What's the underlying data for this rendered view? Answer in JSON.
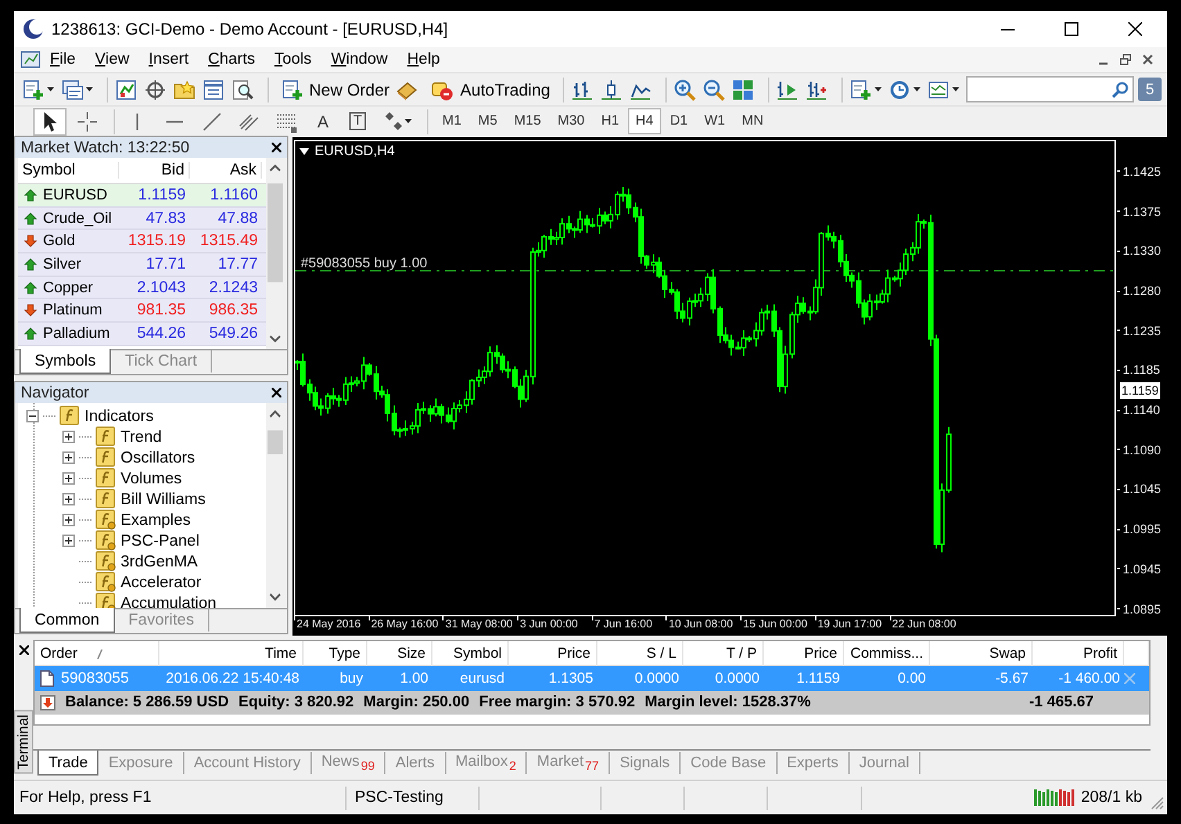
{
  "window": {
    "title": "1238613: GCI-Demo - Demo Account - [EURUSD,H4]"
  },
  "menu": [
    "File",
    "View",
    "Insert",
    "Charts",
    "Tools",
    "Window",
    "Help"
  ],
  "toolbar": {
    "new_order": "New Order",
    "auto_trading": "AutoTrading",
    "notifications": "5"
  },
  "drawing_tools": [
    {
      "kind": "cursor",
      "selected": true
    },
    {
      "kind": "crosshair",
      "selected": false
    },
    {
      "kind": "vertical-line",
      "selected": false
    },
    {
      "kind": "horizontal-line",
      "selected": false
    },
    {
      "kind": "trend-line",
      "selected": false
    },
    {
      "kind": "channel",
      "selected": false
    },
    {
      "kind": "fibonacci",
      "selected": false
    },
    {
      "kind": "text",
      "glyph": "A",
      "selected": false
    },
    {
      "kind": "label",
      "glyph": "T",
      "selected": false
    },
    {
      "kind": "shapes",
      "selected": false
    }
  ],
  "timeframes": [
    {
      "label": "M1",
      "selected": false
    },
    {
      "label": "M5",
      "selected": false
    },
    {
      "label": "M15",
      "selected": false
    },
    {
      "label": "M30",
      "selected": false
    },
    {
      "label": "H1",
      "selected": false
    },
    {
      "label": "H4",
      "selected": true
    },
    {
      "label": "D1",
      "selected": false
    },
    {
      "label": "W1",
      "selected": false
    },
    {
      "label": "MN",
      "selected": false
    }
  ],
  "market_watch": {
    "title": "Market Watch: 13:22:50",
    "columns": [
      "Symbol",
      "Bid",
      "Ask"
    ],
    "rows": [
      {
        "symbol": "EURUSD",
        "bid": "1.1159",
        "ask": "1.1160",
        "rising": true,
        "selected": true
      },
      {
        "symbol": "Crude_Oil",
        "bid": "47.83",
        "ask": "47.88",
        "rising": true,
        "selected": false
      },
      {
        "symbol": "Gold",
        "bid": "1315.19",
        "ask": "1315.49",
        "rising": false,
        "selected": false
      },
      {
        "symbol": "Silver",
        "bid": "17.71",
        "ask": "17.77",
        "rising": true,
        "selected": false
      },
      {
        "symbol": "Copper",
        "bid": "2.1043",
        "ask": "2.1243",
        "rising": true,
        "selected": false
      },
      {
        "symbol": "Platinum",
        "bid": "981.35",
        "ask": "986.35",
        "rising": false,
        "selected": false
      },
      {
        "symbol": "Palladium",
        "bid": "544.26",
        "ask": "549.26",
        "rising": true,
        "selected": false
      }
    ],
    "tabs": [
      {
        "label": "Symbols",
        "selected": true
      },
      {
        "label": "Tick Chart",
        "selected": false
      }
    ]
  },
  "navigator": {
    "title": "Navigator",
    "tree": [
      {
        "label": "Indicators",
        "kind": "folder",
        "expanded": true,
        "children": [
          {
            "label": "Trend",
            "kind": "folder",
            "expanded": false
          },
          {
            "label": "Oscillators",
            "kind": "folder",
            "expanded": false
          },
          {
            "label": "Volumes",
            "kind": "folder",
            "expanded": false
          },
          {
            "label": "Bill Williams",
            "kind": "folder",
            "expanded": false
          },
          {
            "label": "Examples",
            "kind": "custom-folder",
            "expanded": false
          },
          {
            "label": "PSC-Panel",
            "kind": "custom-folder",
            "expanded": false
          },
          {
            "label": "3rdGenMA",
            "kind": "custom"
          },
          {
            "label": "Accelerator",
            "kind": "custom"
          },
          {
            "label": "Accumulation",
            "kind": "custom"
          }
        ]
      }
    ],
    "tabs": [
      {
        "label": "Common",
        "selected": true
      },
      {
        "label": "Favorites",
        "selected": false
      }
    ]
  },
  "chart": {
    "title": "EURUSD,H4",
    "order_label": "#59083055 buy 1.00",
    "price_labels": [
      "1.1425",
      "1.1375",
      "1.1330",
      "1.1280",
      "1.1235",
      "1.1185",
      "1.1140",
      "1.1090",
      "1.1045",
      "1.0995",
      "1.0945",
      "1.0895"
    ],
    "current_price": "1.1159",
    "time_labels": [
      "24 May 2016",
      "26 May 16:00",
      "31 May 08:00",
      "3 Jun 00:00",
      "7 Jun 16:00",
      "10 Jun 08:00",
      "15 Jun 00:00",
      "19 Jun 17:00",
      "22 Jun 08:00"
    ]
  },
  "terminal": {
    "label": "Terminal",
    "columns": [
      "Order",
      "Time",
      "Type",
      "Size",
      "Symbol",
      "Price",
      "S / L",
      "T / P",
      "Price",
      "Commiss...",
      "Swap",
      "Profit"
    ],
    "rows": [
      {
        "cells": [
          "59083055",
          "2016.06.22 15:40:48",
          "buy",
          "1.00",
          "eurusd",
          "1.1305",
          "0.0000",
          "0.0000",
          "1.1159",
          "0.00",
          "-5.67",
          "-1 460.00"
        ],
        "selected": true
      }
    ],
    "summary": {
      "parts": [
        "Balance: 5 286.59 USD",
        "Equity: 3 820.92",
        "Margin: 250.00",
        "Free margin: 3 570.92",
        "Margin level: 1528.37%"
      ],
      "profit": "-1 465.67"
    },
    "tabs": [
      {
        "label": "Trade",
        "selected": true
      },
      {
        "label": "Exposure",
        "selected": false
      },
      {
        "label": "Account History",
        "selected": false
      },
      {
        "label": "News",
        "badge": "99",
        "selected": false
      },
      {
        "label": "Alerts",
        "selected": false
      },
      {
        "label": "Mailbox",
        "badge": "2",
        "selected": false
      },
      {
        "label": "Market",
        "badge": "77",
        "selected": false
      },
      {
        "label": "Signals",
        "selected": false
      },
      {
        "label": "Code Base",
        "selected": false
      },
      {
        "label": "Experts",
        "selected": false
      },
      {
        "label": "Journal",
        "selected": false
      }
    ]
  },
  "status_bar": {
    "help": "For Help, press F1",
    "profile": "PSC-Testing",
    "traffic": "208/1 kb"
  }
}
